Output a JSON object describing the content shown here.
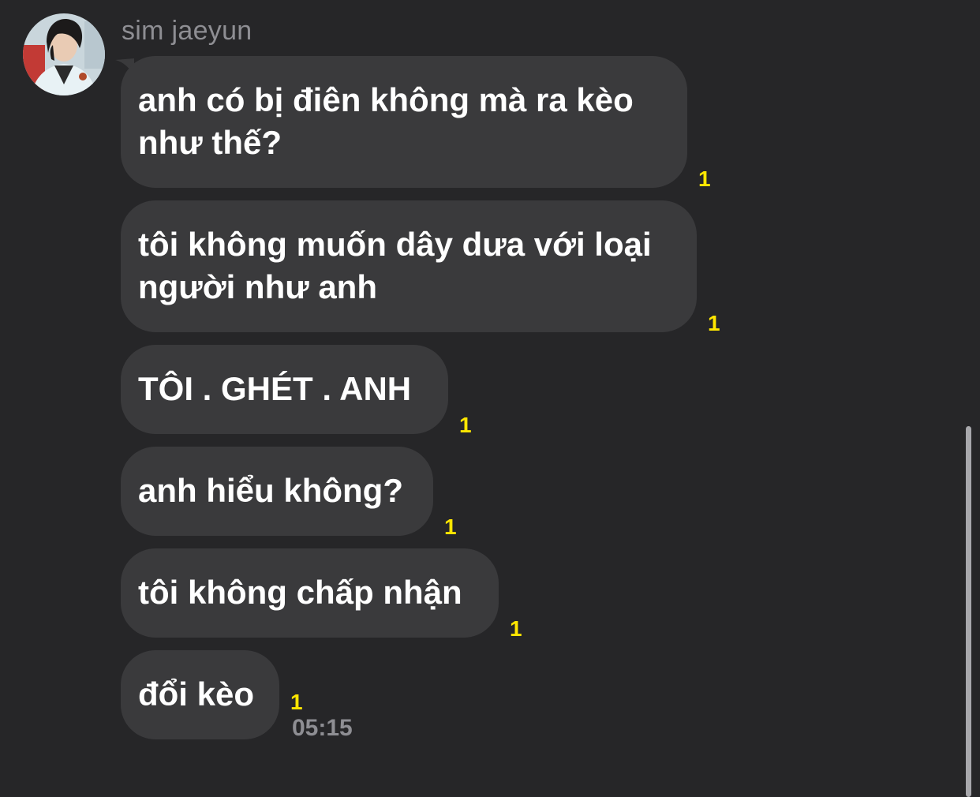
{
  "chat": {
    "sender_name": "sim jaeyun",
    "messages": [
      {
        "text": "anh có bị điên không mà ra kèo\nnhư thế?",
        "unread": "1"
      },
      {
        "text": "tôi không muốn dây dưa với loại\nngười như anh",
        "unread": "1"
      },
      {
        "text": "TÔI . GHÉT . ANH",
        "unread": "1"
      },
      {
        "text": "anh hiểu không?",
        "unread": "1"
      },
      {
        "text": "tôi không chấp nhận",
        "unread": "1"
      },
      {
        "text": "đổi kèo",
        "unread": "1"
      }
    ],
    "last_timestamp": "05:15"
  },
  "colors": {
    "background": "#262628",
    "bubble": "#3a3a3c",
    "unread_count": "#ffe600",
    "muted_text": "#8e8e93"
  },
  "icons": {
    "avatar": "profile-photo"
  }
}
